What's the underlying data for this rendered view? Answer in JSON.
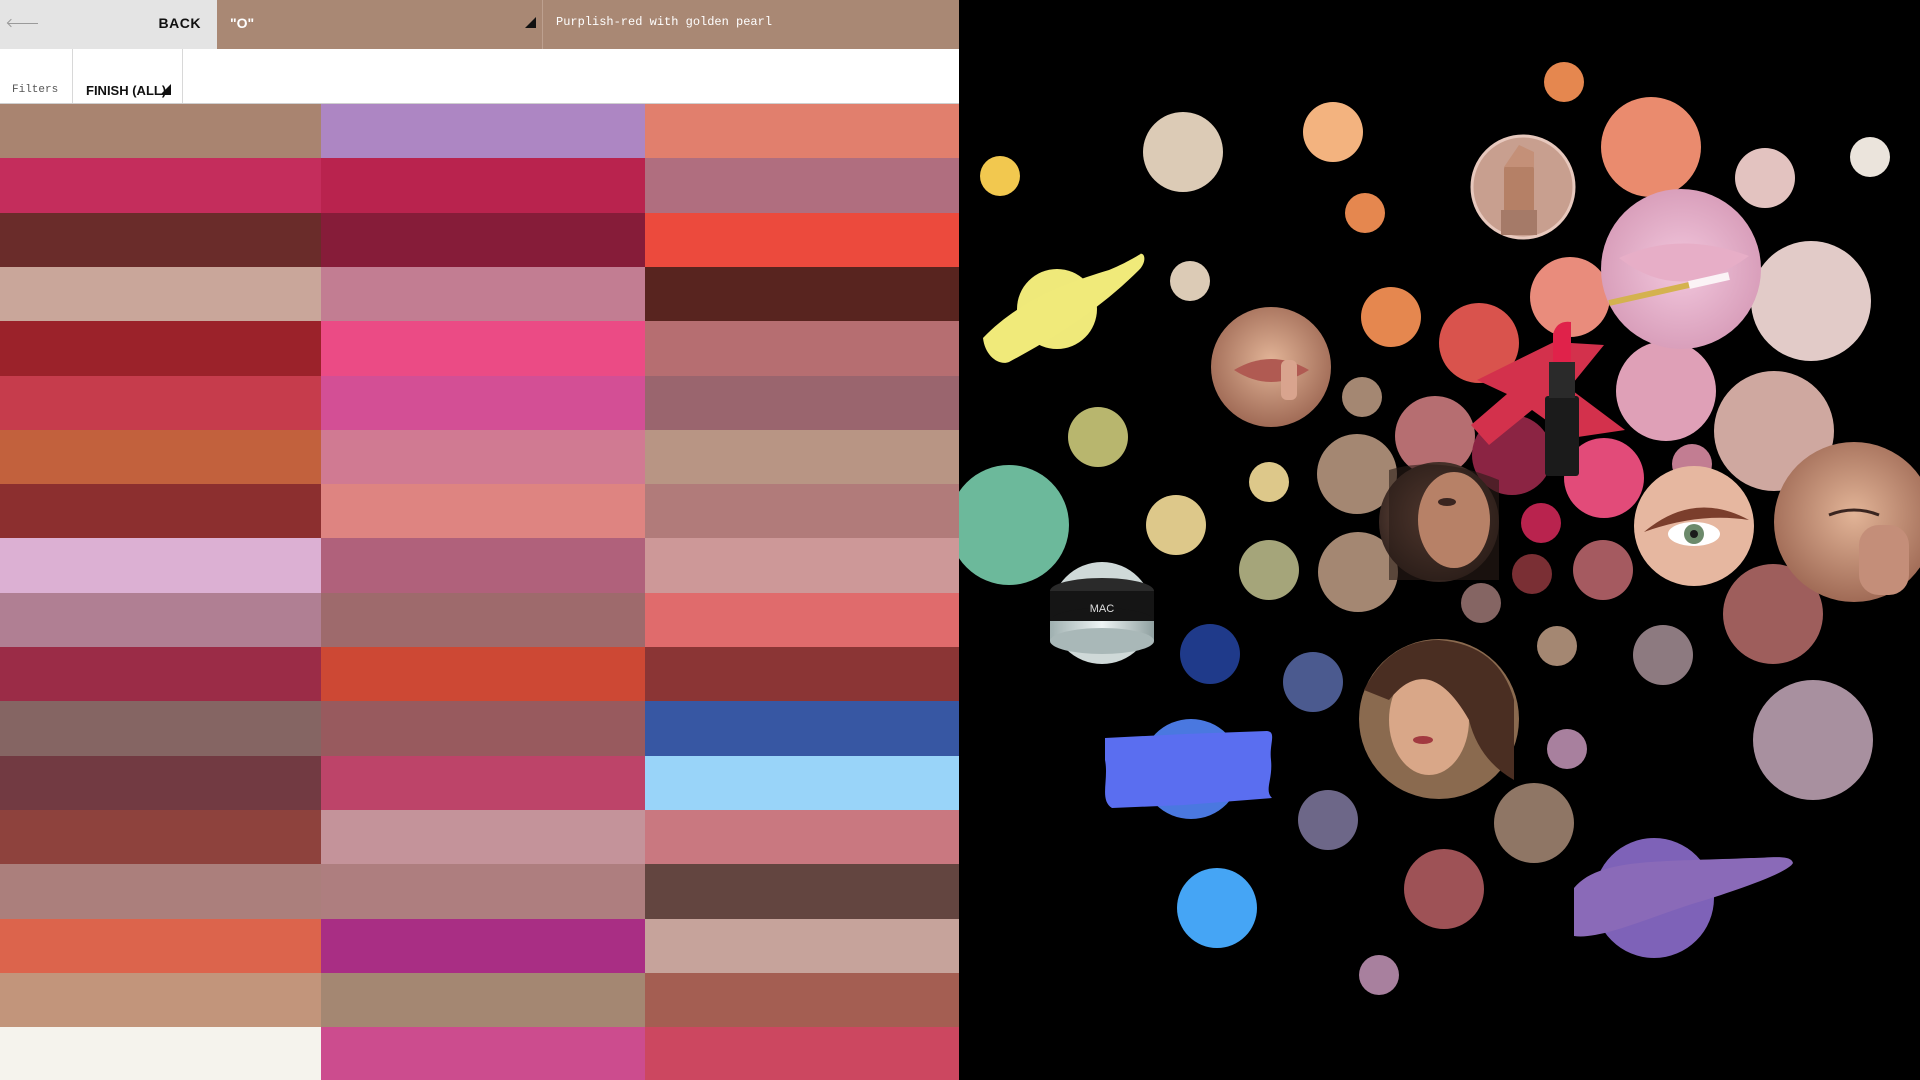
{
  "header": {
    "back_label": "BACK",
    "shade_value": "\"O\"",
    "shade_description": "Purplish-red with golden pearl"
  },
  "filters": {
    "label": "Filters",
    "finish_label": "FINISH (ALL)"
  },
  "swatches": {
    "columns": [
      [
        "#a98470",
        "#c42d5c",
        "#6a2c2a",
        "#c9a69a",
        "#9b222a",
        "#c63c4c",
        "#c2613d",
        "#8c2f2f",
        "#dcb0d3",
        "#b07f93",
        "#9b2c47",
        "#856563",
        "#723a42",
        "#8e423d",
        "#ab7f7c",
        "#dc644c",
        "#c2957b",
        "#f5f3ed"
      ],
      [
        "#ad86c3",
        "#b9234e",
        "#861c39",
        "#c27d92",
        "#eb4b85",
        "#d34f95",
        "#d07a92",
        "#de8481",
        "#b0617b",
        "#9e6a6c",
        "#cd4834",
        "#985a5e",
        "#bd4469",
        "#c4939a",
        "#ae7e7f",
        "#a92e84",
        "#a48772",
        "#cc4c8e"
      ],
      [
        "#e17f6d",
        "#b06e7f",
        "#ec4a3d",
        "#58241f",
        "#b66e71",
        "#9a656e",
        "#b89584",
        "#b17b7a",
        "#cd9898",
        "#e06b6c",
        "#8b3535",
        "#3757a3",
        "#99d4f9",
        "#c97880",
        "#634540",
        "#c6a39b",
        "#a45e52",
        "#cc4760"
      ]
    ]
  },
  "collage": {
    "icons": [
      "lipstick-bullet-icon",
      "lip-gloss-photo-icon",
      "lips-photo-icon",
      "red-lipstick-icon",
      "eye-makeup-photo-icon",
      "face-photo-icon",
      "eyeshadow-photo-icon",
      "eyeliner-pot-icon",
      "blue-paint-swatch-icon",
      "yellow-paint-swatch-icon",
      "purple-shimmer-swatch-icon"
    ],
    "pot_brand": "MAC"
  }
}
